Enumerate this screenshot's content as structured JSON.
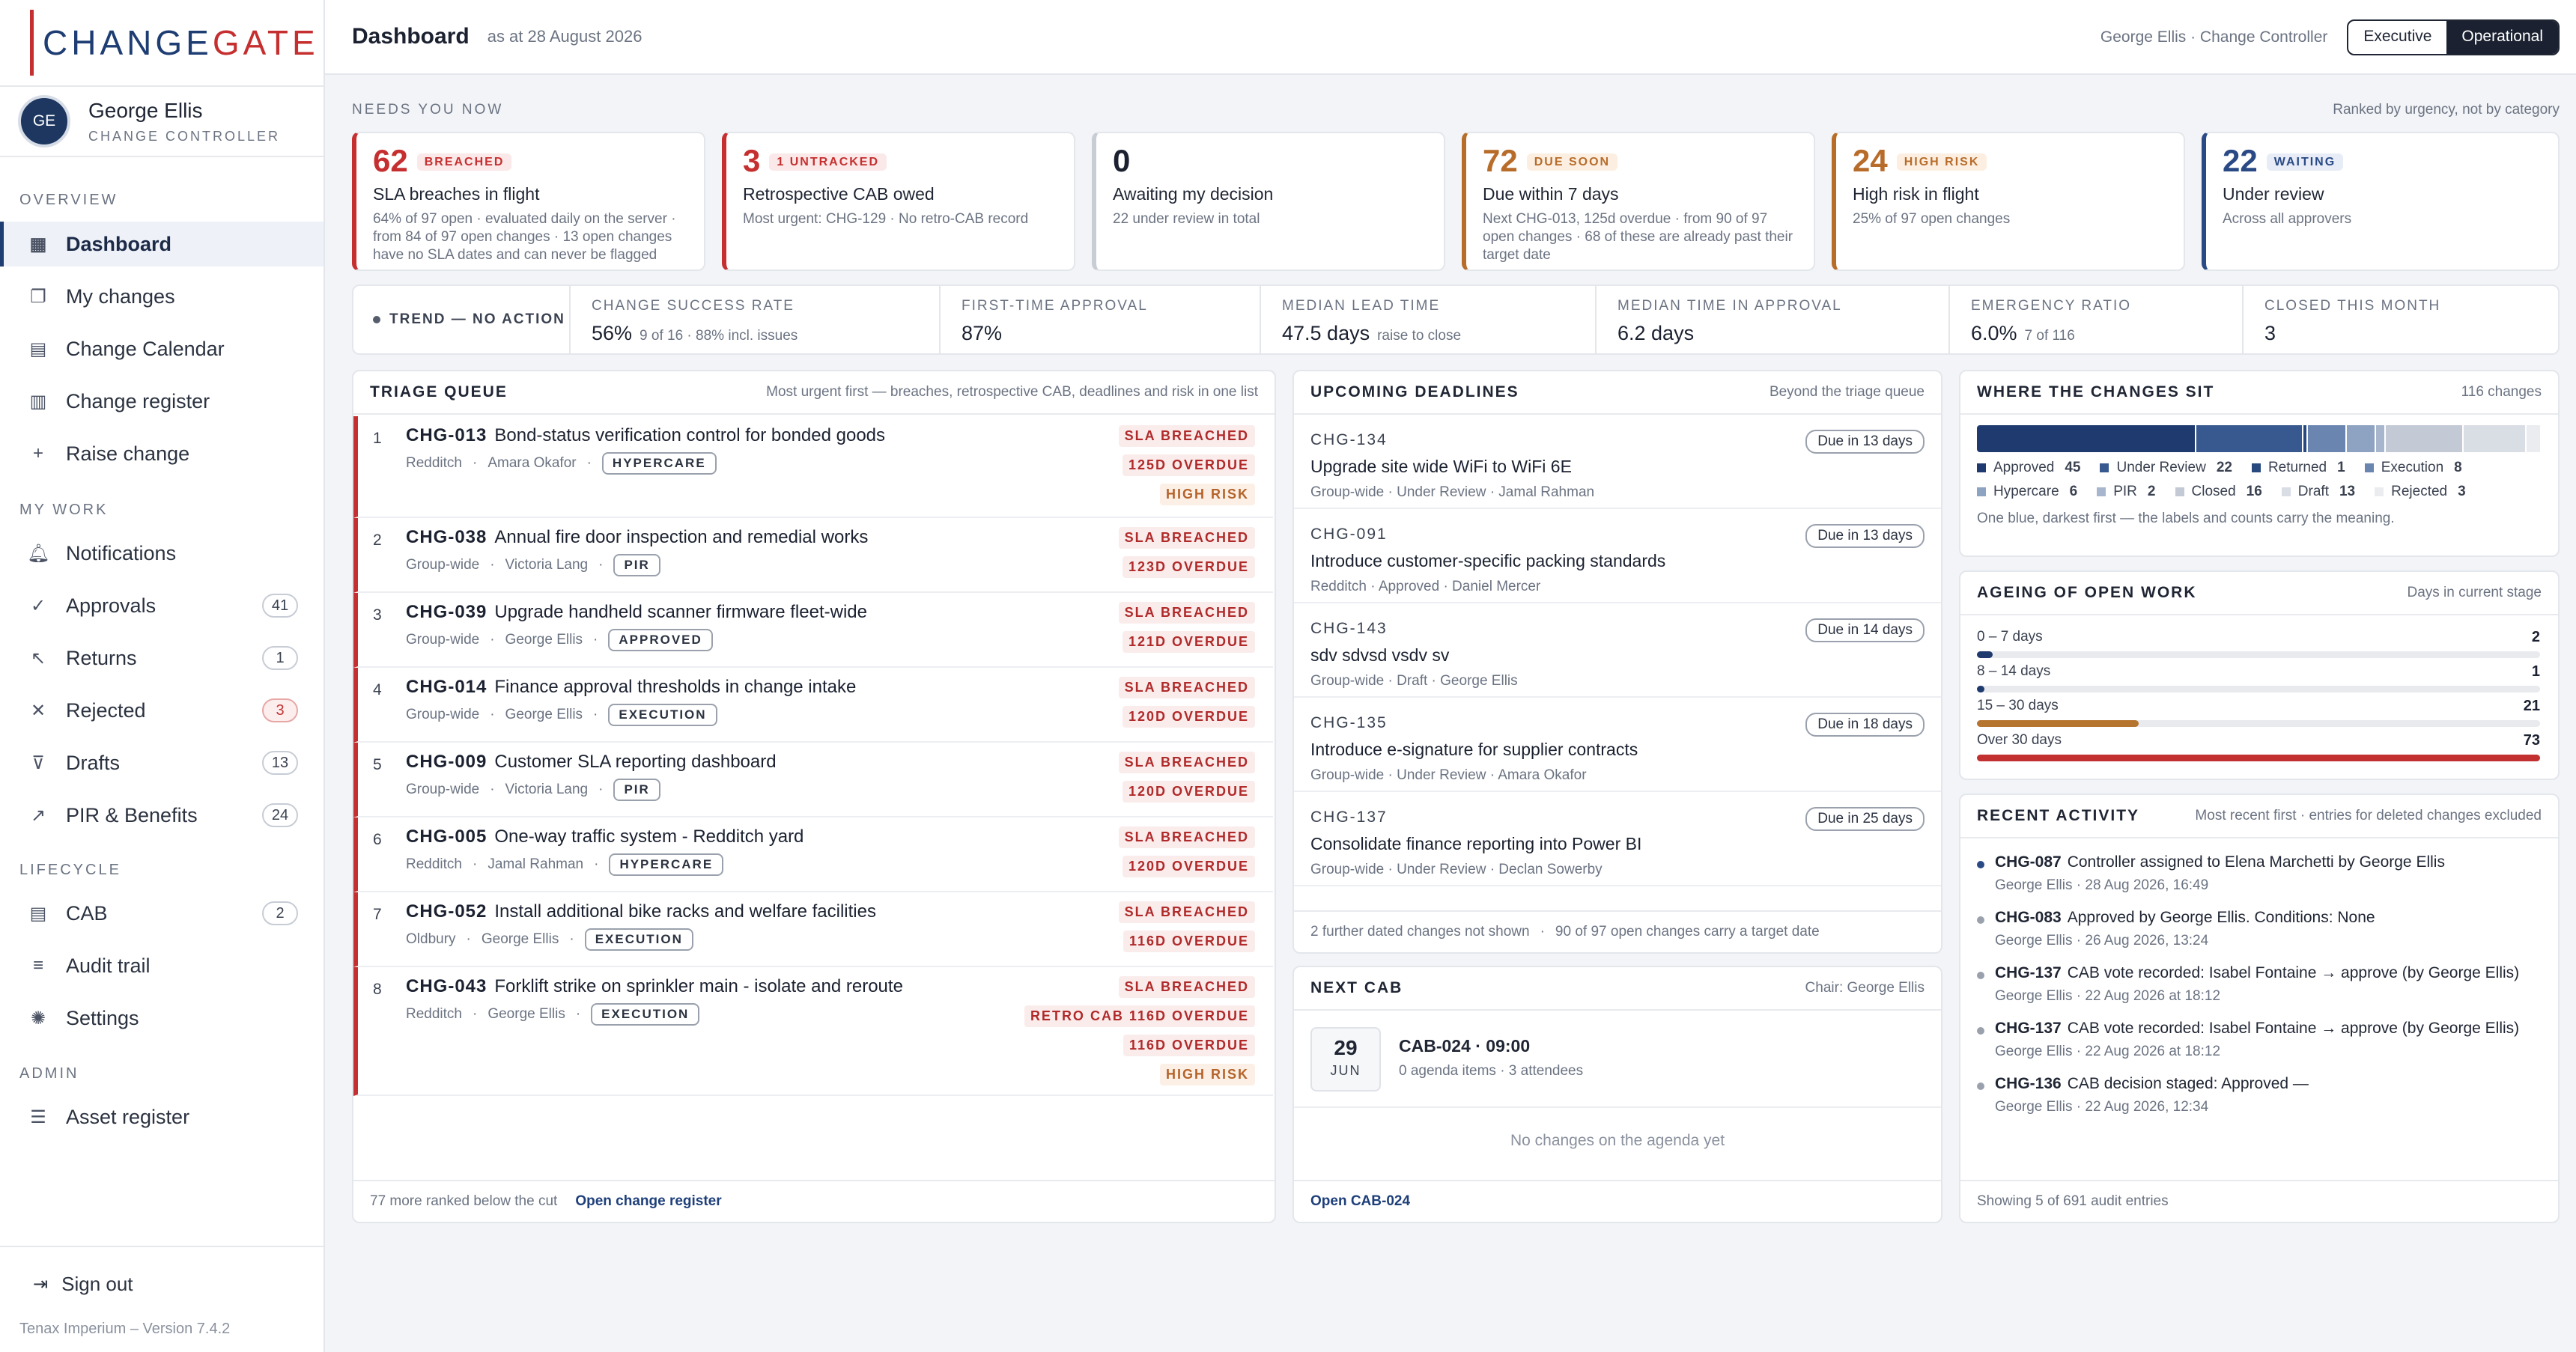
{
  "brand": {
    "part1": "CHANGE",
    "part2": "GATE"
  },
  "user": {
    "initials": "GE",
    "name": "George Ellis",
    "role": "CHANGE CONTROLLER"
  },
  "nav": {
    "overview_label": "OVERVIEW",
    "overview": [
      {
        "label": "Dashboard",
        "icon": "grid-icon"
      },
      {
        "label": "My changes",
        "icon": "stack-icon"
      },
      {
        "label": "Change Calendar",
        "icon": "calendar-icon"
      },
      {
        "label": "Change register",
        "icon": "register-icon"
      },
      {
        "label": "Raise change",
        "icon": "plus-icon"
      }
    ],
    "mywork_label": "MY WORK",
    "mywork": [
      {
        "label": "Notifications",
        "icon": "bell-icon",
        "count": ""
      },
      {
        "label": "Approvals",
        "icon": "check-icon",
        "count": "41"
      },
      {
        "label": "Returns",
        "icon": "return-arrow-icon",
        "count": "1"
      },
      {
        "label": "Rejected",
        "icon": "x-icon",
        "count": "3"
      },
      {
        "label": "Drafts",
        "icon": "funnel-icon",
        "count": "13"
      },
      {
        "label": "PIR & Benefits",
        "icon": "trend-icon",
        "count": "24"
      }
    ],
    "lifecycle_label": "LIFECYCLE",
    "lifecycle": [
      {
        "label": "CAB",
        "icon": "calendar-icon",
        "count": "2"
      },
      {
        "label": "Audit trail",
        "icon": "lines-icon",
        "count": ""
      },
      {
        "label": "Settings",
        "icon": "gear-icon",
        "count": ""
      }
    ],
    "admin_label": "ADMIN",
    "admin": [
      {
        "label": "Asset register",
        "icon": "database-icon"
      }
    ],
    "signout": "Sign out",
    "version": "Tenax Imperium – Version 7.4.2"
  },
  "header": {
    "title": "Dashboard",
    "as_at": "as at 28 August 2026",
    "who": "George Ellis · Change Controller",
    "view_executive": "Executive",
    "view_operational": "Operational"
  },
  "needs": {
    "label": "NEEDS YOU NOW",
    "ranked": "Ranked by urgency, not by category",
    "cards": [
      {
        "num": "62",
        "badge": "BREACHED",
        "title": "SLA breaches in flight",
        "desc": "64% of 97 open · evaluated daily on the server · from 84 of 97 open changes · 13 open changes have no SLA dates and can never be flagged",
        "color": "#c62f2f"
      },
      {
        "num": "3",
        "badge": "1 UNTRACKED",
        "title": "Retrospective CAB owed",
        "desc": "Most urgent: CHG-129 · No retro-CAB record",
        "color": "#c62f2f"
      },
      {
        "num": "0",
        "badge": "",
        "title": "Awaiting my decision",
        "desc": "22 under review in total",
        "color": "#c8ccd3"
      },
      {
        "num": "72",
        "badge": "DUE SOON",
        "title": "Due within 7 days",
        "desc": "Next CHG-013, 125d overdue · from 90 of 97 open changes · 68 of these are already past their target date",
        "color": "#b86c2a"
      },
      {
        "num": "24",
        "badge": "HIGH RISK",
        "title": "High risk in flight",
        "desc": "25% of 97 open changes",
        "color": "#b86c2a"
      },
      {
        "num": "22",
        "badge": "WAITING",
        "title": "Under review",
        "desc": "Across all approvers",
        "color": "#2a4a86"
      }
    ]
  },
  "trend": {
    "label": "TREND — NO ACTION",
    "kpis": [
      {
        "label": "CHANGE SUCCESS RATE",
        "value": "56%",
        "sub": "9 of 16 · 88% incl. issues"
      },
      {
        "label": "FIRST-TIME APPROVAL",
        "value": "87%",
        "sub": ""
      },
      {
        "label": "MEDIAN LEAD TIME",
        "value": "47.5 days",
        "sub": "raise to close"
      },
      {
        "label": "MEDIAN TIME IN APPROVAL",
        "value": "6.2 days",
        "sub": ""
      },
      {
        "label": "EMERGENCY RATIO",
        "value": "6.0%",
        "sub": "7 of 116"
      },
      {
        "label": "CLOSED THIS MONTH",
        "value": "3",
        "sub": ""
      }
    ]
  },
  "triage": {
    "title": "TRIAGE QUEUE",
    "note": "Most urgent first — breaches, retrospective CAB, deadlines and risk in one list",
    "rows": [
      {
        "n": "1",
        "id": "CHG-013",
        "title": "Bond-status verification control for bonded goods",
        "site": "Redditch",
        "owner": "Amara Okafor",
        "stage": "HYPERCARE",
        "tags": [
          "SLA BREACHED",
          "125D OVERDUE"
        ],
        "risk": "HIGH RISK"
      },
      {
        "n": "2",
        "id": "CHG-038",
        "title": "Annual fire door inspection and remedial works",
        "site": "Group-wide",
        "owner": "Victoria Lang",
        "stage": "PIR",
        "tags": [
          "SLA BREACHED",
          "123D OVERDUE"
        ],
        "risk": ""
      },
      {
        "n": "3",
        "id": "CHG-039",
        "title": "Upgrade handheld scanner firmware fleet-wide",
        "site": "Group-wide",
        "owner": "George Ellis",
        "stage": "APPROVED",
        "tags": [
          "SLA BREACHED",
          "121D OVERDUE"
        ],
        "risk": ""
      },
      {
        "n": "4",
        "id": "CHG-014",
        "title": "Finance approval thresholds in change intake",
        "site": "Group-wide",
        "owner": "George Ellis",
        "stage": "EXECUTION",
        "tags": [
          "SLA BREACHED",
          "120D OVERDUE"
        ],
        "risk": ""
      },
      {
        "n": "5",
        "id": "CHG-009",
        "title": "Customer SLA reporting dashboard",
        "site": "Group-wide",
        "owner": "Victoria Lang",
        "stage": "PIR",
        "tags": [
          "SLA BREACHED",
          "120D OVERDUE"
        ],
        "risk": ""
      },
      {
        "n": "6",
        "id": "CHG-005",
        "title": "One-way traffic system - Redditch yard",
        "site": "Redditch",
        "owner": "Jamal Rahman",
        "stage": "HYPERCARE",
        "tags": [
          "SLA BREACHED",
          "120D OVERDUE"
        ],
        "risk": ""
      },
      {
        "n": "7",
        "id": "CHG-052",
        "title": "Install additional bike racks and welfare facilities",
        "site": "Oldbury",
        "owner": "George Ellis",
        "stage": "EXECUTION",
        "tags": [
          "SLA BREACHED",
          "116D OVERDUE"
        ],
        "risk": ""
      },
      {
        "n": "8",
        "id": "CHG-043",
        "title": "Forklift strike on sprinkler main - isolate and reroute",
        "site": "Redditch",
        "owner": "George Ellis",
        "stage": "EXECUTION",
        "tags": [
          "SLA BREACHED",
          "RETRO CAB 116D OVERDUE",
          "116D OVERDUE"
        ],
        "risk": "HIGH RISK"
      }
    ],
    "footer_note": "77 more ranked below the cut",
    "footer_link": "Open change register"
  },
  "deadlines": {
    "title": "UPCOMING DEADLINES",
    "note": "Beyond the triage queue",
    "rows": [
      {
        "id": "CHG-134",
        "title": "Upgrade site wide WiFi to WiFi 6E",
        "meta": "Group-wide · Under Review · Jamal Rahman",
        "due": "Due in 13 days"
      },
      {
        "id": "CHG-091",
        "title": "Introduce customer-specific packing standards",
        "meta": "Redditch · Approved · Daniel Mercer",
        "due": "Due in 13 days"
      },
      {
        "id": "CHG-143",
        "title": "sdv sdvsd vsdv sv",
        "meta": "Group-wide · Draft · George Ellis",
        "due": "Due in 14 days"
      },
      {
        "id": "CHG-135",
        "title": "Introduce e-signature for supplier contracts",
        "meta": "Group-wide · Under Review · Amara Okafor",
        "due": "Due in 18 days"
      },
      {
        "id": "CHG-137",
        "title": "Consolidate finance reporting into Power BI",
        "meta": "Group-wide · Under Review · Declan Sowerby",
        "due": "Due in 25 days"
      }
    ],
    "footer_a": "2 further dated changes not shown",
    "footer_b": "90 of 97 open changes carry a target date"
  },
  "cab": {
    "title": "NEXT CAB",
    "chair": "Chair: George Ellis",
    "day": "29",
    "month": "JUN",
    "name": "CAB-024 · 09:00",
    "sub": "0 agenda items · 3 attendees",
    "empty": "No changes on the agenda yet",
    "link": "Open CAB-024"
  },
  "where": {
    "title": "WHERE THE CHANGES SIT",
    "total": "116 changes",
    "segments": [
      {
        "label": "Approved",
        "value": 45,
        "color": "#1e3a6e"
      },
      {
        "label": "Under Review",
        "value": 22,
        "color": "#37598f"
      },
      {
        "label": "Returned",
        "value": 1,
        "color": "#27497f"
      },
      {
        "label": "Execution",
        "value": 8,
        "color": "#6a85b0"
      },
      {
        "label": "Hypercare",
        "value": 6,
        "color": "#8ea2c2"
      },
      {
        "label": "PIR",
        "value": 2,
        "color": "#a8b6cd"
      },
      {
        "label": "Closed",
        "value": 16,
        "color": "#c3cad6"
      },
      {
        "label": "Draft",
        "value": 13,
        "color": "#d9dde4"
      },
      {
        "label": "Rejected",
        "value": 3,
        "color": "#eaecf0"
      }
    ],
    "note": "One blue, darkest first — the labels and counts carry the meaning."
  },
  "ageing": {
    "title": "AGEING OF OPEN WORK",
    "note": "Days in current stage",
    "max": 73,
    "rows": [
      {
        "label": "0 – 7 days",
        "value": 2,
        "color": "#1e3a6e"
      },
      {
        "label": "8 – 14 days",
        "value": 1,
        "color": "#1e3a6e"
      },
      {
        "label": "15 – 30 days",
        "value": 21,
        "color": "#b6752f"
      },
      {
        "label": "Over 30 days",
        "value": 73,
        "color": "#c23030"
      }
    ]
  },
  "activity": {
    "title": "RECENT ACTIVITY",
    "note": "Most recent first · entries for deleted changes excluded",
    "items": [
      {
        "id": "CHG-087",
        "text": "Controller assigned to Elena Marchetti by George Ellis",
        "meta": "George Ellis · 28 Aug 2026, 16:49",
        "dot": "#2a4a86"
      },
      {
        "id": "CHG-083",
        "text": "Approved by George Ellis. Conditions: None",
        "meta": "George Ellis · 26 Aug 2026, 13:24",
        "dot": "#9aa1ad"
      },
      {
        "id": "CHG-137",
        "text": "CAB vote recorded: Isabel Fontaine → approve (by George Ellis)",
        "meta": "George Ellis · 22 Aug 2026 at 18:12",
        "dot": "#9aa1ad"
      },
      {
        "id": "CHG-137",
        "text": "CAB vote recorded: Isabel Fontaine → approve (by George Ellis)",
        "meta": "George Ellis · 22 Aug 2026 at 18:12",
        "dot": "#9aa1ad"
      },
      {
        "id": "CHG-136",
        "text": "CAB decision staged: Approved —",
        "meta": "George Ellis · 22 Aug 2026, 12:34",
        "dot": "#9aa1ad"
      }
    ],
    "footer": "Showing 5 of 691 audit entries"
  }
}
